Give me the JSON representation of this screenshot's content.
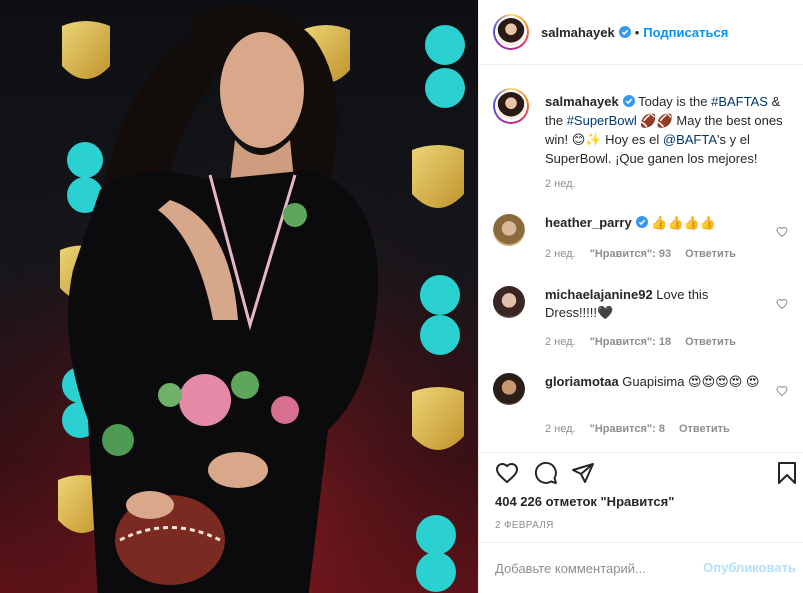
{
  "post": {
    "username": "salmahayek",
    "follow_label": "Подписаться",
    "separator": "•",
    "caption": {
      "username": "salmahayek",
      "text_1": " Today is the ",
      "hashtag_1": "#BAFTAS",
      "text_2": " & the ",
      "hashtag_2": "#SuperBowl",
      "text_3": " 🏈🏈 May the best ones win! 😊✨ Hoy es el ",
      "mention": "@BAFTA",
      "text_4": "'s y el SuperBowl. ¡Que ganen los mejores!",
      "time": "2 нед."
    },
    "comments": [
      {
        "username": "heather_parry",
        "text": " 👍👍👍👍",
        "time": "2 нед.",
        "likes": "\"Нравится\": 93",
        "reply": "Ответить"
      },
      {
        "username": "michaelajanine92",
        "text": " Love this Dress!!!!!🖤",
        "time": "2 нед.",
        "likes": "\"Нравится\": 18",
        "reply": "Ответить"
      },
      {
        "username": "gloriamotaa",
        "text": " Guapisima 😍😍😍😍 😍",
        "time": "2 нед.",
        "likes": "\"Нравится\": 8",
        "reply": "Ответить"
      }
    ],
    "likes_count": "404 226 отметок \"Нравится\"",
    "date": "2 ФЕВРАЛЯ",
    "comment_placeholder": "Добавьте комментарий...",
    "post_label": "Опубликовать"
  },
  "icons": {
    "like": "heart-icon",
    "comment": "comment-icon",
    "share": "share-icon",
    "save": "bookmark-icon",
    "verified": "verified-badge-icon"
  },
  "colors": {
    "link": "#0095f6",
    "hashtag": "#00376b",
    "muted": "#8e8e8e",
    "post_disabled": "#b2dffc"
  }
}
